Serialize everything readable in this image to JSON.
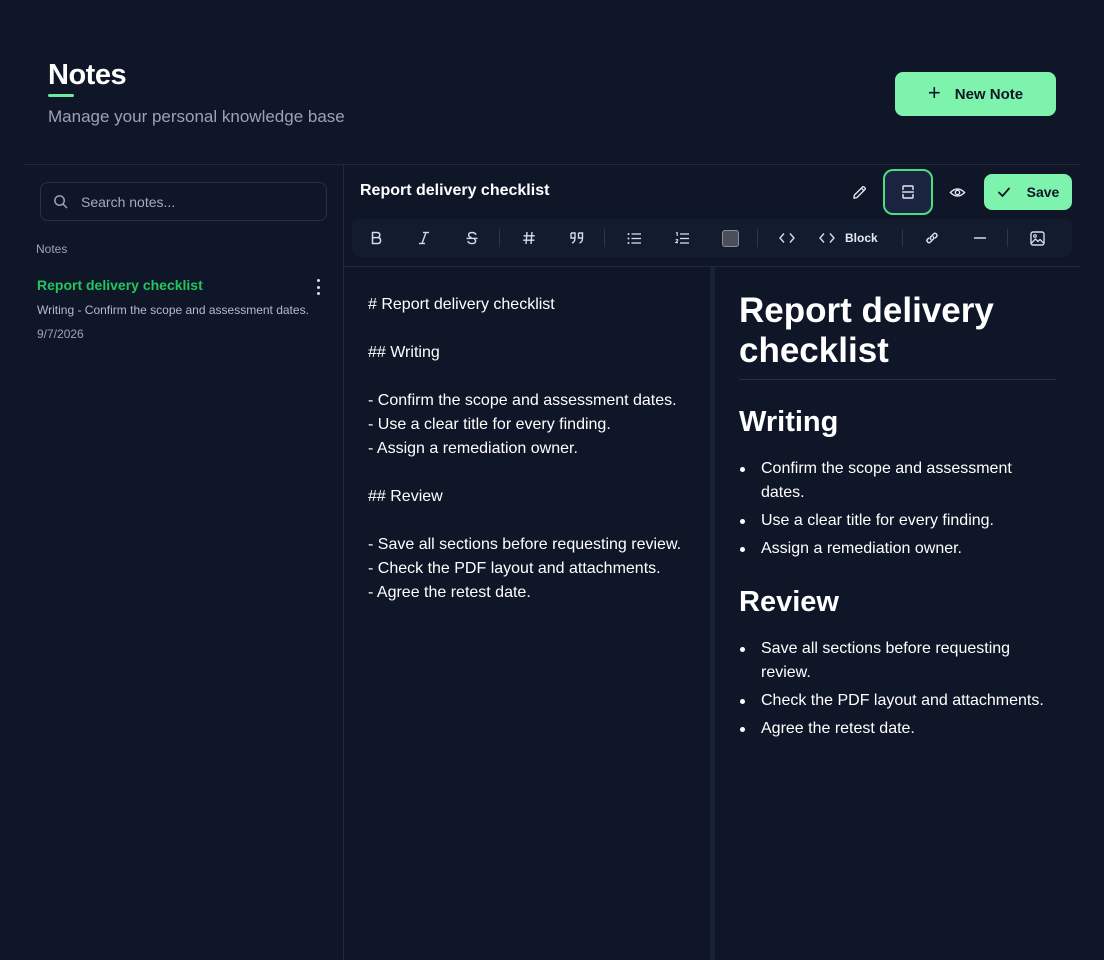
{
  "header": {
    "title": "Notes",
    "subtitle": "Manage your personal knowledge base",
    "new_note_label": "New Note",
    "accent": "#7ef3ad"
  },
  "sidebar": {
    "search_placeholder": "Search notes...",
    "section_label": "Notes",
    "notes": [
      {
        "title": "Report delivery checklist",
        "snippet": "Writing - Confirm the scope and assessment dates.",
        "date": "9/7/2026"
      }
    ]
  },
  "editor": {
    "title": "Report delivery checklist",
    "save_label": "Save",
    "view_modes": [
      "edit-icon",
      "split-view-icon",
      "preview-eye-icon"
    ],
    "active_view": "split",
    "toolbar": {
      "block_label": "Block",
      "icons": [
        "bold-icon",
        "italic-icon",
        "strikethrough-icon",
        "heading-icon",
        "quote-icon",
        "bullet-list-icon",
        "numbered-list-icon",
        "checkbox-icon",
        "inline-code-icon",
        "code-block-icon",
        "link-icon",
        "horizontal-rule-icon",
        "image-icon"
      ]
    },
    "source": "# Report delivery checklist\n\n## Writing\n\n- Confirm the scope and assessment dates.\n- Use a clear title for every finding.\n- Assign a remediation owner.\n\n## Review\n\n- Save all sections before requesting review.\n- Check the PDF layout and attachments.\n- Agree the retest date.",
    "preview": {
      "h1": "Report delivery checklist",
      "sections": [
        {
          "heading": "Writing",
          "items": [
            "Confirm the scope and assessment dates.",
            "Use a clear title for every finding.",
            "Assign a remediation owner."
          ]
        },
        {
          "heading": "Review",
          "items": [
            "Save all sections before requesting review.",
            "Check the PDF layout and attachments.",
            "Agree the retest date."
          ]
        }
      ]
    }
  }
}
